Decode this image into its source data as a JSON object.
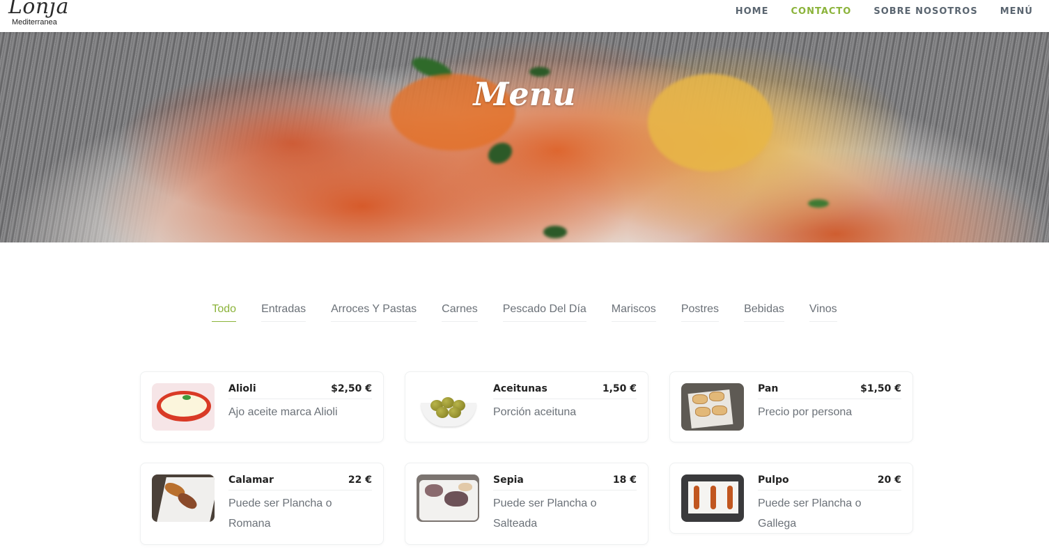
{
  "header": {
    "logo_script": "Lonja",
    "logo_sub": "Mediterranea",
    "nav": [
      {
        "label": "HOME",
        "active": false
      },
      {
        "label": "CONTACTO",
        "active": true
      },
      {
        "label": "SOBRE NOSOTROS",
        "active": false
      },
      {
        "label": "MENÚ",
        "active": false
      }
    ]
  },
  "hero": {
    "title": "Menu"
  },
  "filters": {
    "tabs": [
      "Todo",
      "Entradas",
      "Arroces Y Pastas",
      "Carnes",
      "Pescado Del Día",
      "Mariscos",
      "Postres",
      "Bebidas",
      "Vinos"
    ],
    "active": "Todo"
  },
  "menu_items": [
    {
      "name": "Alioli",
      "price": "$2,50 €",
      "description": "Ajo aceite marca Alioli",
      "image": "alioli-bowl"
    },
    {
      "name": "Aceitunas",
      "price": "1,50 €",
      "description": "Porción aceituna",
      "image": "olives-dish"
    },
    {
      "name": "Pan",
      "price": "$1,50 €",
      "description": "Precio por persona",
      "image": "bread-slices"
    },
    {
      "name": "Calamar",
      "price": "22 €",
      "description": "Puede ser Plancha o Romana",
      "image": "grilled-squid"
    },
    {
      "name": "Sepia",
      "price": "18 €",
      "description": "Puede ser Plancha o Salteada",
      "image": "cuttlefish-plate"
    },
    {
      "name": "Pulpo",
      "price": "20 €",
      "description": "Puede ser Plancha o Gallega",
      "image": "octopus-plates"
    }
  ],
  "colors": {
    "accent": "#8bb33a",
    "text_muted": "#6b7178",
    "nav_text": "#5a6570"
  }
}
